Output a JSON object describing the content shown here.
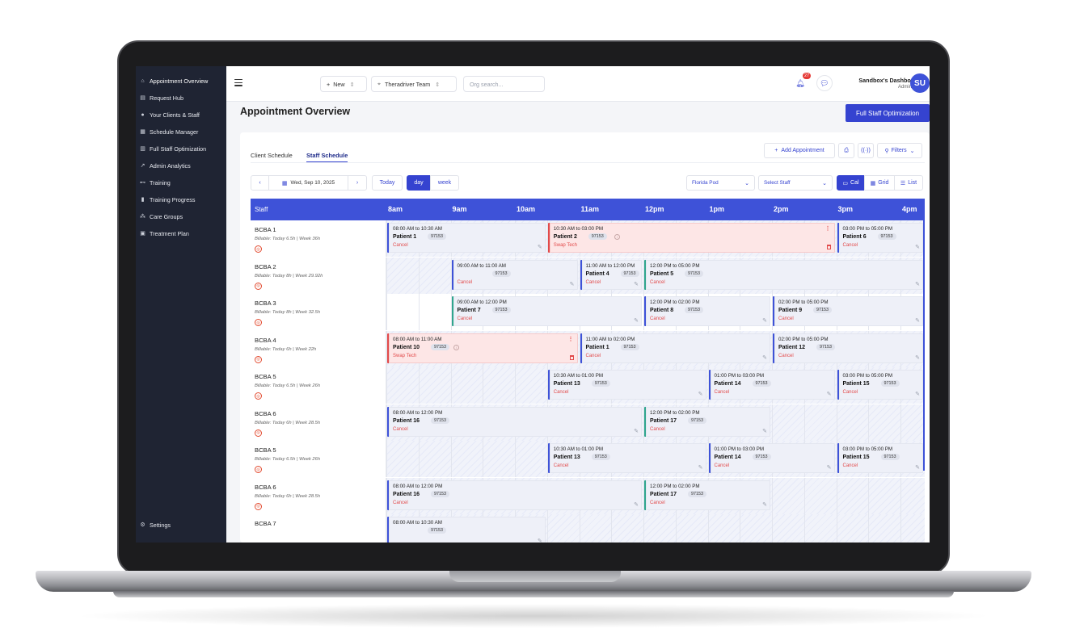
{
  "sidebar": {
    "items": [
      {
        "label": "Appointment Overview",
        "icon": "home-icon"
      },
      {
        "label": "Request Hub",
        "icon": "inbox-icon"
      },
      {
        "label": "Your Clients & Staff",
        "icon": "users-icon"
      },
      {
        "label": "Schedule Manager",
        "icon": "calendar-icon"
      },
      {
        "label": "Full Staff Optimization",
        "icon": "optimize-icon"
      },
      {
        "label": "Admin Analytics",
        "icon": "analytics-icon"
      },
      {
        "label": "Training",
        "icon": "dumbbell-icon"
      },
      {
        "label": "Training Progress",
        "icon": "bar-chart-icon"
      },
      {
        "label": "Care Groups",
        "icon": "group-icon"
      },
      {
        "label": "Treatment Plan",
        "icon": "clipboard-icon"
      }
    ],
    "settings_label": "Settings"
  },
  "topbar": {
    "new_label": "New",
    "team_label": "Theradriver Team",
    "org_search_placeholder": "Org search...",
    "notification_count": "27",
    "user_name": "Sandbox's Dashboard",
    "user_role": "Admin",
    "avatar_initials": "SU"
  },
  "page": {
    "title": "Appointment Overview",
    "optimize_button": "Full Staff Optimization"
  },
  "tabs": [
    "Client Schedule",
    "Staff Schedule"
  ],
  "toolbar": {
    "add_appointment": "Add Appointment",
    "filters": "Filters"
  },
  "controls": {
    "date": "Wed, Sep 10, 2025",
    "today": "Today",
    "day": "day",
    "week": "week",
    "pod": "Florida Pod",
    "staff_select": "Select Staff",
    "view_cal": "Cal",
    "view_grid": "Grid",
    "view_list": "List"
  },
  "grid": {
    "staff_header": "Staff",
    "hours": [
      "8am",
      "9am",
      "10am",
      "11am",
      "12pm",
      "1pm",
      "2pm",
      "3pm",
      "4pm"
    ],
    "rows": [
      {
        "name": "BCBA 1",
        "meta": "Billable: Today 6.5h | Week 36h",
        "appts": [
          {
            "time": "08:00 AM to 10:30 AM",
            "patient": "Patient 1",
            "code": "97153",
            "action": "Cancel",
            "start": 8,
            "end": 10.5,
            "style": "blue"
          },
          {
            "time": "10:30 AM to 03:00 PM",
            "patient": "Patient 2",
            "code": "97153",
            "action": "Swap Tech",
            "start": 10.5,
            "end": 15,
            "style": "pink"
          },
          {
            "time": "03:00 PM to 05:00 PM",
            "patient": "Patient 6",
            "code": "97153",
            "action": "Cancel",
            "start": 15,
            "end": 16.4,
            "style": "blue"
          }
        ]
      },
      {
        "name": "BCBA 2",
        "meta": "Billable: Today 8h | Week 29.92h",
        "appts": [
          {
            "time": "09:00 AM to 11:00 AM",
            "patient": "",
            "code": "97153",
            "action": "Cancel",
            "start": 9,
            "end": 11,
            "style": "blue"
          },
          {
            "time": "11:00 AM to 12:00 PM",
            "patient": "Patient 4",
            "code": "97153",
            "action": "Cancel",
            "start": 11,
            "end": 12,
            "style": "blue"
          },
          {
            "time": "12:00 PM to 05:00 PM",
            "patient": "Patient 5",
            "code": "97153",
            "action": "Cancel",
            "start": 12,
            "end": 16.4,
            "style": "teal"
          }
        ]
      },
      {
        "name": "BCBA 3",
        "meta": "Billable: Today 8h | Week 32.5h",
        "appts": [
          {
            "time": "09:00 AM to 12:00 PM",
            "patient": "Patient 7",
            "code": "97153",
            "action": "Cancel",
            "start": 9,
            "end": 12,
            "style": "teal"
          },
          {
            "time": "12:00 PM to 02:00 PM",
            "patient": "Patient 8",
            "code": "97153",
            "action": "Cancel",
            "start": 12,
            "end": 14,
            "style": "blue"
          },
          {
            "time": "02:00 PM to 05:00 PM",
            "patient": "Patient 9",
            "code": "97153",
            "action": "Cancel",
            "start": 14,
            "end": 16.4,
            "style": "blue"
          }
        ]
      },
      {
        "name": "BCBA 4",
        "meta": "Billable: Today 6h | Week 22h",
        "appts": [
          {
            "time": "08:00 AM to 11:00 AM",
            "patient": "Patient 10",
            "code": "97153",
            "action": "Swap Tech",
            "start": 8,
            "end": 11,
            "style": "pink"
          },
          {
            "time": "11:00 AM to 02:00 PM",
            "patient": "Patient 1",
            "code": "97153",
            "action": "Cancel",
            "start": 11,
            "end": 14,
            "style": "blue"
          },
          {
            "time": "02:00 PM to 05:00 PM",
            "patient": "Patient 12",
            "code": "97153",
            "action": "Cancel",
            "start": 14,
            "end": 16.4,
            "style": "blue"
          }
        ]
      },
      {
        "name": "BCBA 5",
        "meta": "Billable: Today 6.5h | Week 26h",
        "appts": [
          {
            "time": "10:30 AM to 01:00 PM",
            "patient": "Patient 13",
            "code": "97153",
            "action": "Cancel",
            "start": 10.5,
            "end": 13,
            "style": "blue"
          },
          {
            "time": "01:00 PM to 03:00 PM",
            "patient": "Patient 14",
            "code": "97153",
            "action": "Cancel",
            "start": 13,
            "end": 15,
            "style": "blue"
          },
          {
            "time": "03:00 PM to 05:00 PM",
            "patient": "Patient 15",
            "code": "97153",
            "action": "Cancel",
            "start": 15,
            "end": 16.4,
            "style": "blue"
          }
        ]
      },
      {
        "name": "BCBA 6",
        "meta": "Billable: Today 6h | Week 28.5h",
        "appts": [
          {
            "time": "08:00 AM to 12:00 PM",
            "patient": "Patient 16",
            "code": "97153",
            "action": "Cancel",
            "start": 8,
            "end": 12,
            "style": "blue"
          },
          {
            "time": "12:00 PM to 02:00 PM",
            "patient": "Patient 17",
            "code": "97153",
            "action": "Cancel",
            "start": 12,
            "end": 14,
            "style": "teal"
          }
        ]
      },
      {
        "name": "BCBA 5",
        "meta": "Billable: Today 6.5h | Week 26h",
        "appts": [
          {
            "time": "10:30 AM to 01:00 PM",
            "patient": "Patient 13",
            "code": "97153",
            "action": "Cancel",
            "start": 10.5,
            "end": 13,
            "style": "blue"
          },
          {
            "time": "01:00 PM to 03:00 PM",
            "patient": "Patient 14",
            "code": "97153",
            "action": "Cancel",
            "start": 13,
            "end": 15,
            "style": "blue"
          },
          {
            "time": "03:00 PM to 05:00 PM",
            "patient": "Patient 15",
            "code": "97153",
            "action": "Cancel",
            "start": 15,
            "end": 16.4,
            "style": "blue"
          }
        ]
      },
      {
        "name": "BCBA 6",
        "meta": "Billable: Today 6h | Week 28.5h",
        "appts": [
          {
            "time": "08:00 AM to 12:00 PM",
            "patient": "Patient 16",
            "code": "97153",
            "action": "Cancel",
            "start": 8,
            "end": 12,
            "style": "blue"
          },
          {
            "time": "12:00 PM to 02:00 PM",
            "patient": "Patient 17",
            "code": "97153",
            "action": "Cancel",
            "start": 12,
            "end": 14,
            "style": "teal"
          }
        ]
      },
      {
        "name": "BCBA 7",
        "meta": "",
        "appts": [
          {
            "time": "08:00 AM to 10:30 AM",
            "patient": "",
            "code": "97153",
            "action": "",
            "start": 8,
            "end": 10.5,
            "style": "blue"
          }
        ]
      }
    ]
  },
  "colors": {
    "primary": "#3e52d8",
    "sidebar": "#1f2433",
    "cancel": "#e24a4a",
    "teal": "#2fa58d"
  }
}
